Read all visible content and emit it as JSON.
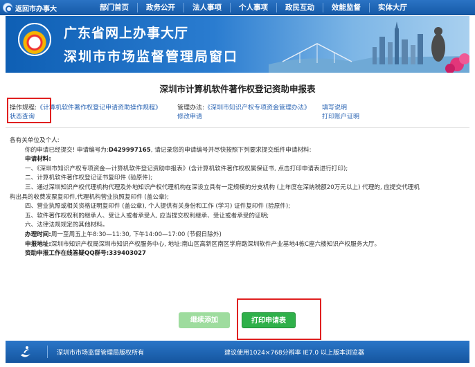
{
  "topbar": {
    "home_label": "返回市办事大",
    "nav": [
      "部门首页",
      "政务公开",
      "法人事项",
      "个人事项",
      "政民互动",
      "效能监督",
      "实体大厅"
    ]
  },
  "banner": {
    "title_line1": "广东省网上办事大厅",
    "title_line2": "深圳市市场监督管理局窗口"
  },
  "page_title": "深圳市计算机软件著作权登记资助申报表",
  "ops": {
    "rules_label": "操作规程:",
    "rules_link": "《计算机软件著作权登记申请资助操作规程》",
    "status_link": "状态查询",
    "policy_label": "管理办法:",
    "policy_link": "《深圳市知识产权专项资金管理办法》",
    "modify_link": "修改申请",
    "guide_link": "填写说明",
    "receipt_link": "打印账户证明"
  },
  "content": {
    "greeting": "各有关单位及个人:",
    "submitted_prefix": "你的申请已经提交! 申请编号为:",
    "app_number": "D429997165",
    "submitted_suffix": ", 请记录您的申请编号并尽快按照下列要求提交纸件申请材料:",
    "materials_title": "申请材料:",
    "item1": "一、《深圳市知识产权专项资金—计算机软件登记资助申报表》(含计算机软件著作权权属保证书, 点击打印申请表进行打印);",
    "item2": "二、计算机软件著作权登记证书复印件 (验原件);",
    "item3a": "三、通过深圳知识产权代理机构代理及外地知识产权代理机构在深设立具有一定规模的分支机构 (上年度在深纳税额20万元以上) 代理的, 应提交代理机",
    "item3b": "构出具的收费发票复印件,代理机构营业执照复印件 (盖公章);",
    "item4": "四、营业执照或相关资格证明复印件 (盖公章), 个人提供有关身份和工作 (学习) 证件复印件 (验原件);",
    "item5": "五、软件著作权权利的继承人、受让人或者承受人, 应当提交权利继承、受让或者承受的证明;",
    "item6": "六、法律法规规定的其他材料。",
    "hours_label": "办理时间:",
    "hours_value": "周一至周五上午8:30—11:30, 下午14:00—17:00 (节假日除外)",
    "address_label": "申报地址:",
    "address_value": "深圳市知识产权局深圳市知识产权服务中心, 地址:南山区高新区南区学府路深圳软件产业基地4栋C座六楼知识产权服务大厅。",
    "qq_label": "资助申报工作在线答疑QQ群号:",
    "qq_value": "339403027"
  },
  "buttons": {
    "continue": "继续添加",
    "print": "打印申请表"
  },
  "footer": {
    "copyright": "深圳市市场监督管理局版权所有",
    "browser_tip": "建议使用1024×768分辨率 IE7.0 以上版本浏览器"
  },
  "colors": {
    "nav_bg": "#1d63b6",
    "link": "#2a64b3",
    "print_button": "#2fb04a",
    "continue_button": "#9edc9e",
    "highlight": "#e02020"
  }
}
